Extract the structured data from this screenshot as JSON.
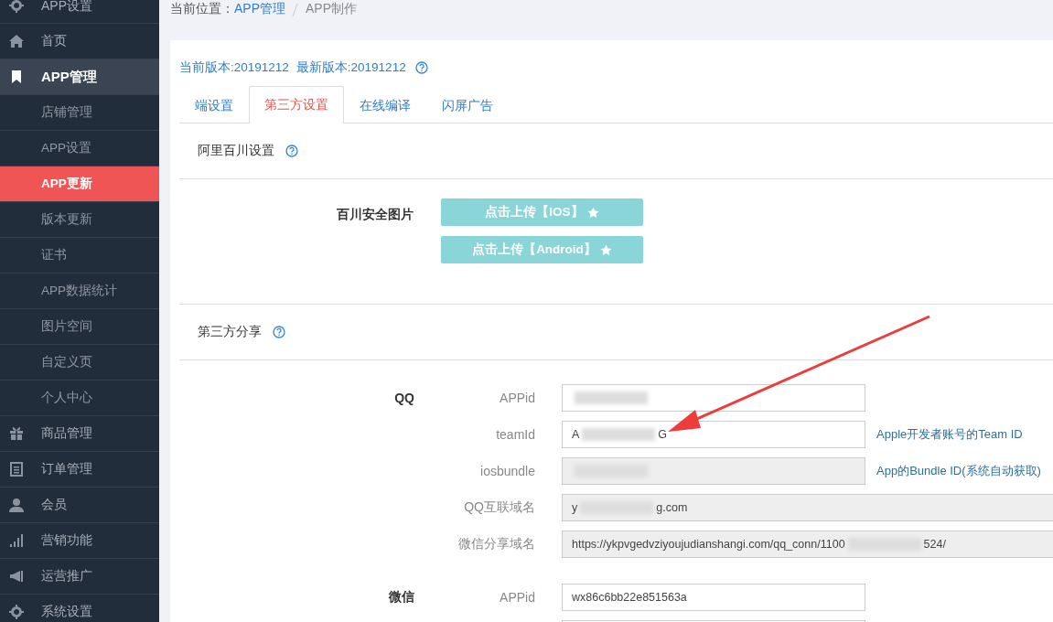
{
  "sidebar": {
    "items": [
      {
        "label": "APP设置",
        "selected": false,
        "sub": false
      },
      {
        "label": "首页",
        "selected": false,
        "sub": false
      },
      {
        "label": "APP管理",
        "selected": false,
        "expanded": true,
        "sub": false
      },
      {
        "label": "店铺管理",
        "selected": false,
        "sub": true
      },
      {
        "label": "APP设置",
        "selected": false,
        "sub": true
      },
      {
        "label": "APP更新",
        "selected": true,
        "sub": true
      },
      {
        "label": "版本更新",
        "selected": false,
        "sub": true
      },
      {
        "label": "证书",
        "selected": false,
        "sub": true
      },
      {
        "label": "APP数据统计",
        "selected": false,
        "sub": true
      },
      {
        "label": "图片空间",
        "selected": false,
        "sub": true
      },
      {
        "label": "自定义页",
        "selected": false,
        "sub": true
      },
      {
        "label": "个人中心",
        "selected": false,
        "sub": true
      },
      {
        "label": "商品管理",
        "selected": false,
        "sub": false
      },
      {
        "label": "订单管理",
        "selected": false,
        "sub": false
      },
      {
        "label": "会员",
        "selected": false,
        "sub": false
      },
      {
        "label": "营销功能",
        "selected": false,
        "sub": false
      },
      {
        "label": "运营推广",
        "selected": false,
        "sub": false
      },
      {
        "label": "系统设置",
        "selected": false,
        "sub": false
      }
    ]
  },
  "breadcrumb": {
    "prefix": "当前位置：",
    "items": [
      {
        "label": "APP管理",
        "link": true
      },
      {
        "label": "APP制作",
        "link": false
      }
    ]
  },
  "version": {
    "current": "当前版本:20191212",
    "latest": "最新版本:20191212"
  },
  "tabs": [
    {
      "label": "端设置",
      "selected": false
    },
    {
      "label": "第三方设置",
      "selected": true
    },
    {
      "label": "在线编译",
      "selected": false
    },
    {
      "label": "闪屏广告",
      "selected": false
    }
  ],
  "sections": [
    {
      "title": "阿里百川设置",
      "kind": "upload",
      "label": "百川安全图片",
      "buttons": [
        "点击上传【IOS】",
        "点击上传【Android】"
      ]
    },
    {
      "title": "第三方分享",
      "kind": "form",
      "groups": [
        {
          "name": "QQ",
          "fields": [
            {
              "label": "APPid",
              "redacted": true,
              "disabled": false,
              "wide": false
            },
            {
              "label": "teamId",
              "prefix": "A",
              "suffix": "G",
              "redacted": true,
              "disabled": false,
              "wide": false,
              "hint": "Apple开发者账号的Team ID"
            },
            {
              "label": "iosbundle",
              "redacted": true,
              "disabled": true,
              "wide": false,
              "hint": "App的Bundle ID(系统自动获取)"
            },
            {
              "label": "QQ互联域名",
              "prefix": "y",
              "suffix": "g.com",
              "redacted": true,
              "disabled": true,
              "wide": true
            },
            {
              "label": "微信分享域名",
              "prefix": "https://ykpvgedvziyoujudianshangi.com/qq_conn/1100",
              "suffix": "524/",
              "redacted": true,
              "disabled": true,
              "wide": true
            }
          ]
        },
        {
          "name": "微信",
          "fields": [
            {
              "label": "APPid",
              "prefix": "wx86c6bb22e851563a",
              "redacted": false,
              "disabled": false,
              "wide": false
            },
            {
              "disabled": false
            }
          ]
        }
      ]
    }
  ]
}
